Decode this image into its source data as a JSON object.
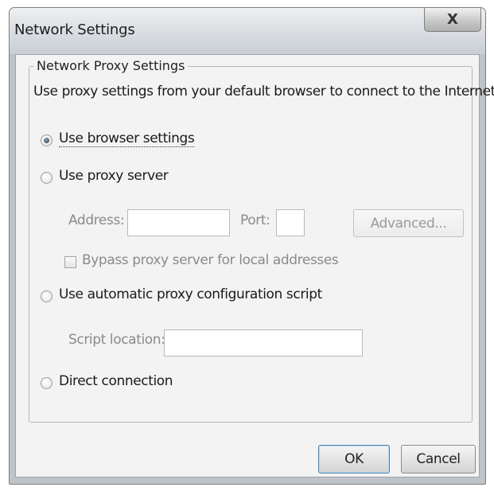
{
  "window": {
    "title": "Network Settings",
    "close_label": "X"
  },
  "proxy_group": {
    "legend": "Network Proxy Settings",
    "description": "Use proxy settings from your default browser to connect to the Internet.",
    "options": {
      "browser": {
        "label": "Use browser settings",
        "selected": true
      },
      "proxy": {
        "label": "Use proxy server",
        "selected": false
      },
      "auto": {
        "label": "Use automatic proxy configuration script",
        "selected": false
      },
      "direct": {
        "label": "Direct connection",
        "selected": false
      }
    },
    "address": {
      "label": "Address:",
      "value": ""
    },
    "port": {
      "label": "Port:",
      "value": ""
    },
    "advanced_label": "Advanced...",
    "bypass": {
      "label": "Bypass proxy server for local addresses",
      "checked": false
    },
    "script_location": {
      "label": "Script location:",
      "value": ""
    }
  },
  "buttons": {
    "ok": "OK",
    "cancel": "Cancel"
  }
}
